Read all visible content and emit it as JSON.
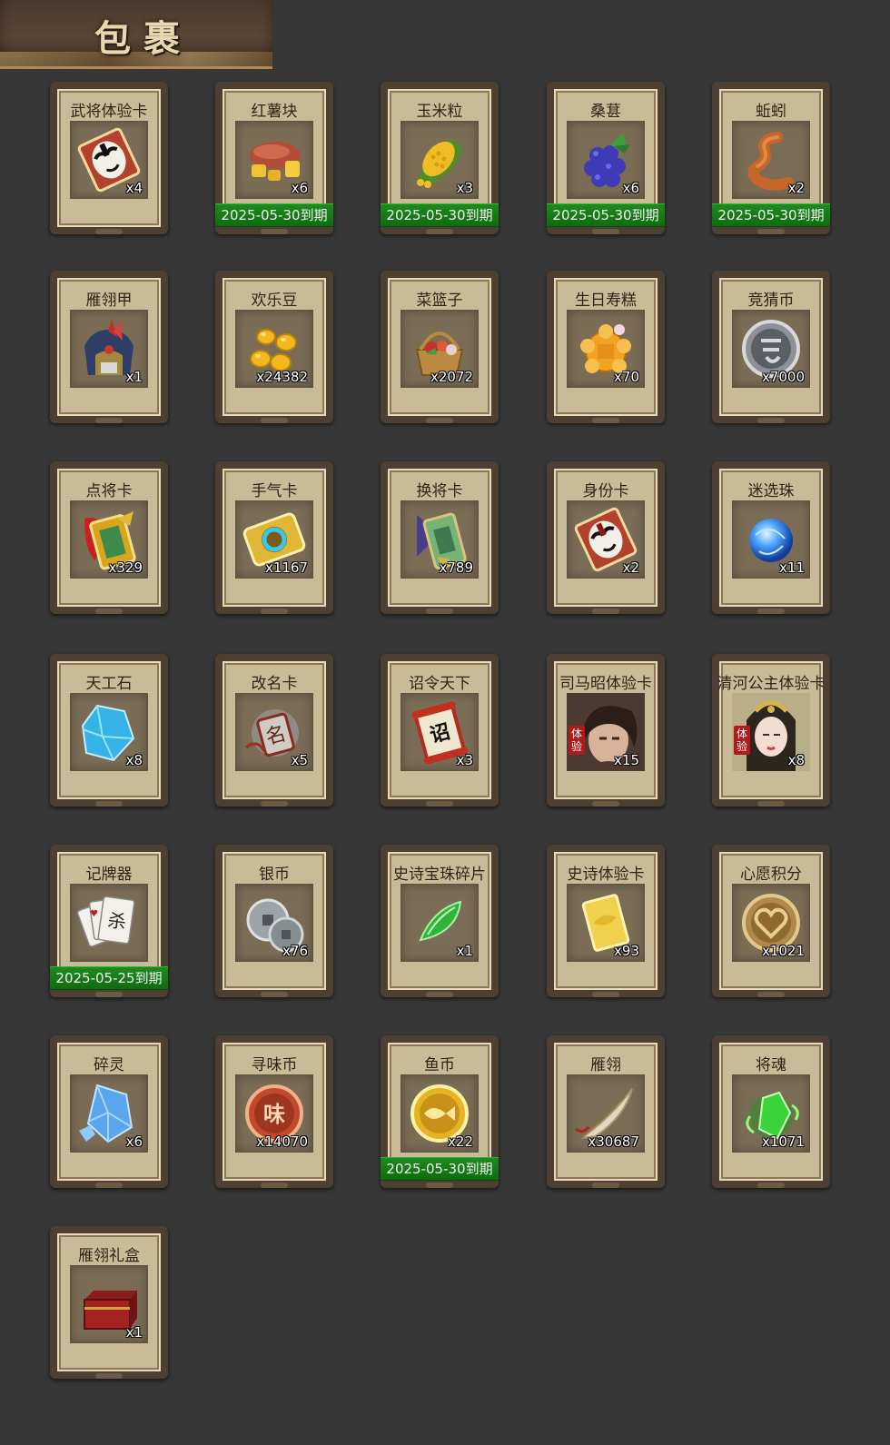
{
  "header": {
    "title": "包裹"
  },
  "items": [
    {
      "name": "武将体验卡",
      "qty": "x4",
      "icon": "opera-mask-card-icon",
      "expiry": ""
    },
    {
      "name": "红薯块",
      "qty": "x6",
      "icon": "sweet-potato-icon",
      "expiry": "2025-05-30到期"
    },
    {
      "name": "玉米粒",
      "qty": "x3",
      "icon": "corn-icon",
      "expiry": "2025-05-30到期"
    },
    {
      "name": "桑葚",
      "qty": "x6",
      "icon": "mulberry-icon",
      "expiry": "2025-05-30到期"
    },
    {
      "name": "蚯蚓",
      "qty": "x2",
      "icon": "worm-icon",
      "expiry": "2025-05-30到期"
    },
    {
      "name": "雁翎甲",
      "qty": "x1",
      "icon": "armor-icon",
      "expiry": ""
    },
    {
      "name": "欢乐豆",
      "qty": "x24382",
      "icon": "gold-beans-icon",
      "expiry": ""
    },
    {
      "name": "菜篮子",
      "qty": "x2072",
      "icon": "basket-icon",
      "expiry": ""
    },
    {
      "name": "生日寿糕",
      "qty": "x70",
      "icon": "birthday-cake-icon",
      "expiry": ""
    },
    {
      "name": "竞猜币",
      "qty": "x7000",
      "icon": "silver-coin-icon",
      "expiry": ""
    },
    {
      "name": "点将卡",
      "qty": "x329",
      "icon": "general-card-icon",
      "expiry": ""
    },
    {
      "name": "手气卡",
      "qty": "x1167",
      "icon": "luck-card-icon",
      "expiry": ""
    },
    {
      "name": "换将卡",
      "qty": "x789",
      "icon": "swap-card-icon",
      "expiry": ""
    },
    {
      "name": "身份卡",
      "qty": "x2",
      "icon": "identity-card-icon",
      "expiry": ""
    },
    {
      "name": "迷选珠",
      "qty": "x11",
      "icon": "blue-orb-icon",
      "expiry": ""
    },
    {
      "name": "天工石",
      "qty": "x8",
      "icon": "blue-gem-icon",
      "expiry": ""
    },
    {
      "name": "改名卡",
      "qty": "x5",
      "icon": "rename-card-icon",
      "expiry": ""
    },
    {
      "name": "诏令天下",
      "qty": "x3",
      "icon": "scroll-icon",
      "expiry": ""
    },
    {
      "name": "司马昭体验卡",
      "qty": "x15",
      "icon": "hero-portrait-male-icon",
      "expiry": "",
      "badge": "体验"
    },
    {
      "name": "清河公主体验卡",
      "qty": "x8",
      "icon": "hero-portrait-female-icon",
      "expiry": "",
      "badge": "体验"
    },
    {
      "name": "记牌器",
      "qty": "",
      "icon": "playing-cards-icon",
      "expiry": "2025-05-25到期"
    },
    {
      "name": "银币",
      "qty": "x76",
      "icon": "silver-coins-icon",
      "expiry": ""
    },
    {
      "name": "史诗宝珠碎片",
      "qty": "x1",
      "icon": "green-shard-icon",
      "expiry": ""
    },
    {
      "name": "史诗体验卡",
      "qty": "x93",
      "icon": "gold-card-icon",
      "expiry": ""
    },
    {
      "name": "心愿积分",
      "qty": "x1021",
      "icon": "heart-coin-icon",
      "expiry": ""
    },
    {
      "name": "碎灵",
      "qty": "x6",
      "icon": "crystal-shard-icon",
      "expiry": ""
    },
    {
      "name": "寻味币",
      "qty": "x14070",
      "icon": "copper-coin-icon",
      "expiry": ""
    },
    {
      "name": "鱼币",
      "qty": "x22",
      "icon": "fish-coin-icon",
      "expiry": "2025-05-30到期"
    },
    {
      "name": "雁翎",
      "qty": "x30687",
      "icon": "feather-icon",
      "expiry": ""
    },
    {
      "name": "将魂",
      "qty": "x1071",
      "icon": "green-soul-icon",
      "expiry": ""
    },
    {
      "name": "雁翎礼盒",
      "qty": "x1",
      "icon": "gift-box-icon",
      "expiry": ""
    }
  ]
}
